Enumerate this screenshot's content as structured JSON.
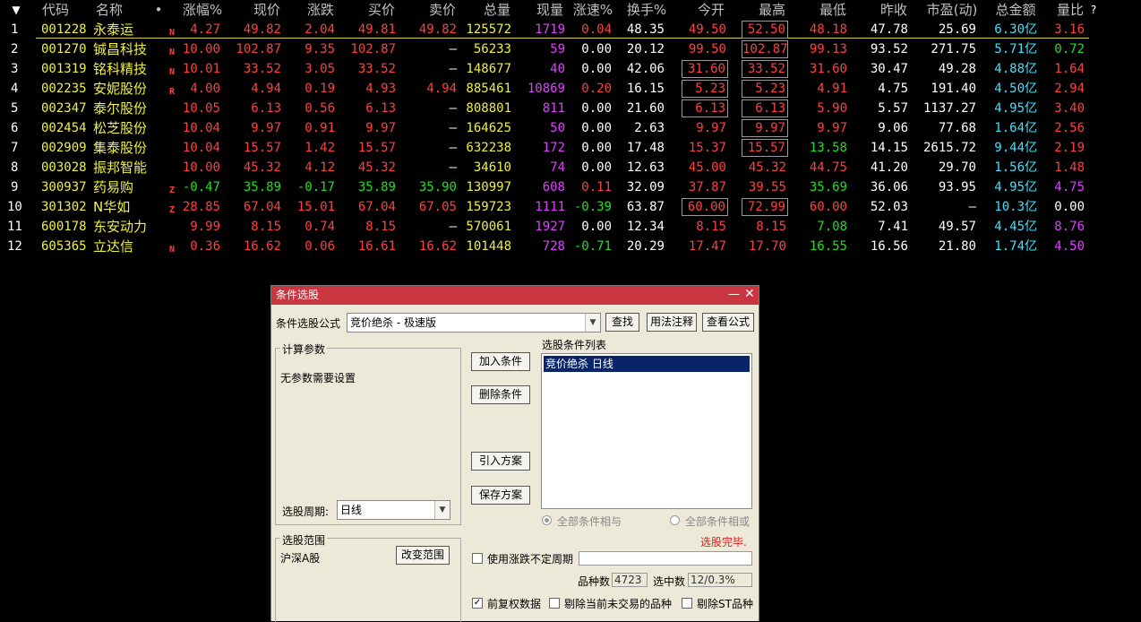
{
  "columns": [
    {
      "key": "sort",
      "label": "▼"
    },
    {
      "key": "code",
      "label": "代码"
    },
    {
      "key": "name",
      "label": "名称"
    },
    {
      "key": "dot",
      "label": "•"
    },
    {
      "key": "chg_pct",
      "label": "涨幅%"
    },
    {
      "key": "price",
      "label": "现价"
    },
    {
      "key": "chg",
      "label": "涨跌"
    },
    {
      "key": "bid",
      "label": "买价"
    },
    {
      "key": "ask",
      "label": "卖价"
    },
    {
      "key": "volume",
      "label": "总量"
    },
    {
      "key": "cur_vol",
      "label": "现量"
    },
    {
      "key": "speed",
      "label": "涨速%"
    },
    {
      "key": "turnover",
      "label": "换手%"
    },
    {
      "key": "open",
      "label": "今开"
    },
    {
      "key": "high",
      "label": "最高"
    },
    {
      "key": "low",
      "label": "最低"
    },
    {
      "key": "prev_close",
      "label": "昨收"
    },
    {
      "key": "pe",
      "label": "市盈(动)"
    },
    {
      "key": "amount",
      "label": "总金额"
    },
    {
      "key": "vol_ratio",
      "label": "量比"
    },
    {
      "key": "help",
      "label": "?"
    }
  ],
  "rows": [
    {
      "idx": "1",
      "code": "001228",
      "name": "永泰运",
      "flag": "N",
      "chg_pct": "4.27",
      "price": "49.82",
      "chg": "2.04",
      "bid": "49.81",
      "ask": "49.82",
      "volume": "125572",
      "cur_vol": "1719",
      "speed": "0.04",
      "turnover": "48.35",
      "open": "49.50",
      "high": "52.50",
      "low": "48.18",
      "prev_close": "47.78",
      "pe": "25.69",
      "amount": "6.30亿",
      "vol_ratio": "3.16"
    },
    {
      "idx": "2",
      "code": "001270",
      "name": "铖昌科技",
      "flag": "N",
      "chg_pct": "10.00",
      "price": "102.87",
      "chg": "9.35",
      "bid": "102.87",
      "ask": "—",
      "volume": "56233",
      "cur_vol": "59",
      "speed": "0.00",
      "turnover": "20.12",
      "open": "99.50",
      "high": "102.87",
      "low": "99.13",
      "prev_close": "93.52",
      "pe": "271.75",
      "amount": "5.71亿",
      "vol_ratio": "0.72"
    },
    {
      "idx": "3",
      "code": "001319",
      "name": "铭科精技",
      "flag": "N",
      "chg_pct": "10.01",
      "price": "33.52",
      "chg": "3.05",
      "bid": "33.52",
      "ask": "—",
      "volume": "148677",
      "cur_vol": "40",
      "speed": "0.00",
      "turnover": "42.06",
      "open": "31.60",
      "high": "33.52",
      "low": "31.60",
      "prev_close": "30.47",
      "pe": "49.28",
      "amount": "4.88亿",
      "vol_ratio": "1.64"
    },
    {
      "idx": "4",
      "code": "002235",
      "name": "安妮股份",
      "flag": "R",
      "chg_pct": "4.00",
      "price": "4.94",
      "chg": "0.19",
      "bid": "4.93",
      "ask": "4.94",
      "volume": "885461",
      "cur_vol": "10869",
      "speed": "0.20",
      "turnover": "16.15",
      "open": "5.23",
      "high": "5.23",
      "low": "4.91",
      "prev_close": "4.75",
      "pe": "191.40",
      "amount": "4.50亿",
      "vol_ratio": "2.94"
    },
    {
      "idx": "5",
      "code": "002347",
      "name": "泰尔股份",
      "flag": "",
      "chg_pct": "10.05",
      "price": "6.13",
      "chg": "0.56",
      "bid": "6.13",
      "ask": "—",
      "volume": "808801",
      "cur_vol": "811",
      "speed": "0.00",
      "turnover": "21.60",
      "open": "6.13",
      "high": "6.13",
      "low": "5.90",
      "prev_close": "5.57",
      "pe": "1137.27",
      "amount": "4.95亿",
      "vol_ratio": "3.40"
    },
    {
      "idx": "6",
      "code": "002454",
      "name": "松芝股份",
      "flag": "",
      "chg_pct": "10.04",
      "price": "9.97",
      "chg": "0.91",
      "bid": "9.97",
      "ask": "—",
      "volume": "164625",
      "cur_vol": "50",
      "speed": "0.00",
      "turnover": "2.63",
      "open": "9.97",
      "high": "9.97",
      "low": "9.97",
      "prev_close": "9.06",
      "pe": "77.68",
      "amount": "1.64亿",
      "vol_ratio": "2.56"
    },
    {
      "idx": "7",
      "code": "002909",
      "name": "集泰股份",
      "flag": "",
      "chg_pct": "10.04",
      "price": "15.57",
      "chg": "1.42",
      "bid": "15.57",
      "ask": "—",
      "volume": "632238",
      "cur_vol": "172",
      "speed": "0.00",
      "turnover": "17.48",
      "open": "15.37",
      "high": "15.57",
      "low": "13.58",
      "prev_close": "14.15",
      "pe": "2615.72",
      "amount": "9.44亿",
      "vol_ratio": "2.19"
    },
    {
      "idx": "8",
      "code": "003028",
      "name": "振邦智能",
      "flag": "",
      "chg_pct": "10.00",
      "price": "45.32",
      "chg": "4.12",
      "bid": "45.32",
      "ask": "—",
      "volume": "34610",
      "cur_vol": "74",
      "speed": "0.00",
      "turnover": "12.63",
      "open": "45.00",
      "high": "45.32",
      "low": "44.75",
      "prev_close": "41.20",
      "pe": "29.70",
      "amount": "1.56亿",
      "vol_ratio": "1.48"
    },
    {
      "idx": "9",
      "code": "300937",
      "name": "药易购",
      "flag": "Z",
      "chg_pct": "-0.47",
      "price": "35.89",
      "chg": "-0.17",
      "bid": "35.89",
      "ask": "35.90",
      "volume": "130997",
      "cur_vol": "608",
      "speed": "0.11",
      "turnover": "32.09",
      "open": "37.87",
      "high": "39.55",
      "low": "35.69",
      "prev_close": "36.06",
      "pe": "93.95",
      "amount": "4.95亿",
      "vol_ratio": "4.75"
    },
    {
      "idx": "10",
      "code": "301302",
      "name": "N华如",
      "flag": "Z",
      "chg_pct": "28.85",
      "price": "67.04",
      "chg": "15.01",
      "bid": "67.04",
      "ask": "67.05",
      "volume": "159723",
      "cur_vol": "1111",
      "speed": "-0.39",
      "turnover": "63.87",
      "open": "60.00",
      "high": "72.99",
      "low": "60.00",
      "prev_close": "52.03",
      "pe": "—",
      "amount": "10.3亿",
      "vol_ratio": "0.00"
    },
    {
      "idx": "11",
      "code": "600178",
      "name": "东安动力",
      "flag": "",
      "chg_pct": "9.99",
      "price": "8.15",
      "chg": "0.74",
      "bid": "8.15",
      "ask": "—",
      "volume": "570061",
      "cur_vol": "1927",
      "speed": "0.00",
      "turnover": "12.34",
      "open": "8.15",
      "high": "8.15",
      "low": "7.08",
      "prev_close": "7.41",
      "pe": "49.57",
      "amount": "4.45亿",
      "vol_ratio": "8.76"
    },
    {
      "idx": "12",
      "code": "605365",
      "name": "立达信",
      "flag": "N",
      "chg_pct": "0.36",
      "price": "16.62",
      "chg": "0.06",
      "bid": "16.61",
      "ask": "16.62",
      "volume": "101448",
      "cur_vol": "728",
      "speed": "-0.71",
      "turnover": "20.29",
      "open": "17.47",
      "high": "17.70",
      "low": "16.55",
      "prev_close": "16.56",
      "pe": "21.80",
      "amount": "1.74亿",
      "vol_ratio": "4.50"
    }
  ],
  "boxed": [
    {
      "row": 1,
      "col": "high"
    },
    {
      "row": 2,
      "col": "high"
    },
    {
      "row": 3,
      "col": "open"
    },
    {
      "row": 3,
      "col": "high"
    },
    {
      "row": 4,
      "col": "open"
    },
    {
      "row": 4,
      "col": "high"
    },
    {
      "row": 5,
      "col": "open"
    },
    {
      "row": 5,
      "col": "high"
    },
    {
      "row": 6,
      "col": "high"
    },
    {
      "row": 7,
      "col": "high"
    },
    {
      "row": 10,
      "col": "open"
    },
    {
      "row": 10,
      "col": "high"
    }
  ],
  "colors": {
    "up": "#ff4040",
    "down": "#20e020",
    "flat": "#ffffff",
    "code": "#f0f040",
    "volume": "#f0f040",
    "cur_vol": "#e040ff",
    "amount": "#40e0ff",
    "title_bar": "#c9363f",
    "list_select": "#0a246a"
  },
  "dialog": {
    "title": "条件选股",
    "formula_label": "条件选股公式",
    "formula_value": "竞价绝杀    - 极速版",
    "find_btn": "查找",
    "usage_btn": "用法注释",
    "view_btn": "查看公式",
    "params_group": "计算参数",
    "params_text": "无参数需要设置",
    "period_label": "选股周期:",
    "period_value": "日线",
    "add_btn": "加入条件",
    "delete_btn": "删除条件",
    "import_btn": "引入方案",
    "save_btn": "保存方案",
    "list_label": "选股条件列表",
    "list_items": [
      "竞价绝杀  日线"
    ],
    "radio_and": "全部条件相与",
    "radio_or": "全部条件相或",
    "status": "选股完毕.",
    "scope_group": "选股范围",
    "scope_value": "沪深A股",
    "change_scope_btn": "改变范围",
    "use_irregular": "使用涨跌不定周期",
    "count_label": "品种数",
    "count_value": "4723",
    "selected_label": "选中数",
    "selected_value": "12/0.3%",
    "fq_label": "前复权数据",
    "exclude_untraded": "剔除当前未交易的品种",
    "exclude_st": "剔除ST品种"
  }
}
